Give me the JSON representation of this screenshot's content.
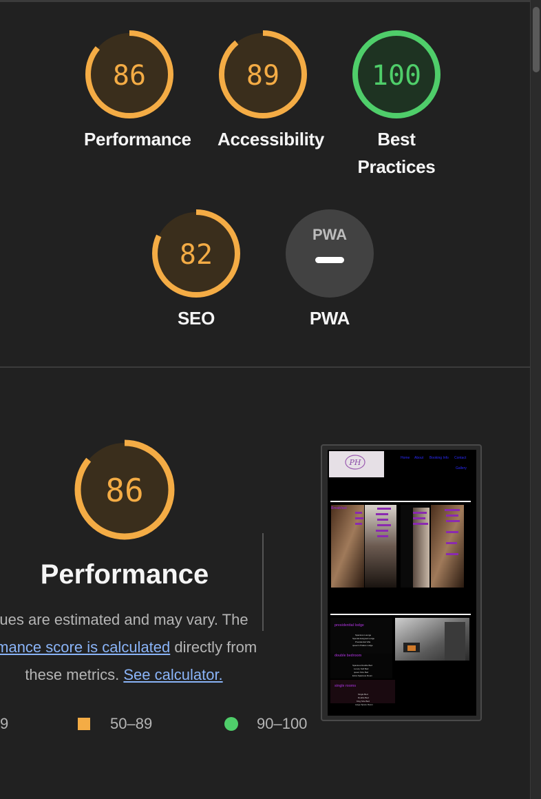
{
  "colors": {
    "average": "#f4ac45",
    "average_bg": "#3a2e1c",
    "pass": "#4fce6a",
    "pass_bg": "#1e3322",
    "na_bg": "#424242"
  },
  "scores": [
    {
      "value": "86",
      "label": "Performance",
      "rating": "average"
    },
    {
      "value": "89",
      "label": "Accessibility",
      "rating": "average"
    },
    {
      "value": "100",
      "label_line1": "Best",
      "label_line2": "Practices",
      "rating": "pass"
    },
    {
      "value": "82",
      "label": "SEO",
      "rating": "average"
    },
    {
      "value": "",
      "badge": "PWA",
      "label": "PWA",
      "rating": "na"
    }
  ],
  "performance": {
    "score": "86",
    "title": "Performance",
    "desc_line1": "ues are estimated and may vary. The",
    "desc_link1": "rmance score is calculated",
    "desc_after_link1": " directly from",
    "desc_line3_text": "these metrics. ",
    "desc_link2": "See calculator."
  },
  "legend": {
    "fail_range": "9",
    "average_range": "50–89",
    "pass_range": "90–100"
  },
  "screenshot": {
    "nav_items": [
      "Home",
      "About",
      "Booking Info",
      "Contact",
      "Gallery"
    ],
    "menu_heading": "Breakfast",
    "rooms": [
      {
        "title": "presidential lodge",
        "items": [
          "Spacious Lounge",
          "Special designed Lodge",
          "Presidential Villa",
          "queen's Palace Lodge"
        ]
      },
      {
        "title": "double bedroom",
        "items": [
          "Spacious Double Bed",
          "Luxury Soft Bed",
          "queen Size Bed",
          "Extra Spacious Room"
        ]
      },
      {
        "title": "single rooms",
        "items": [
          "Single Bed",
          "Double Bed",
          "King Size Bed",
          "Large Space Room"
        ]
      }
    ]
  }
}
